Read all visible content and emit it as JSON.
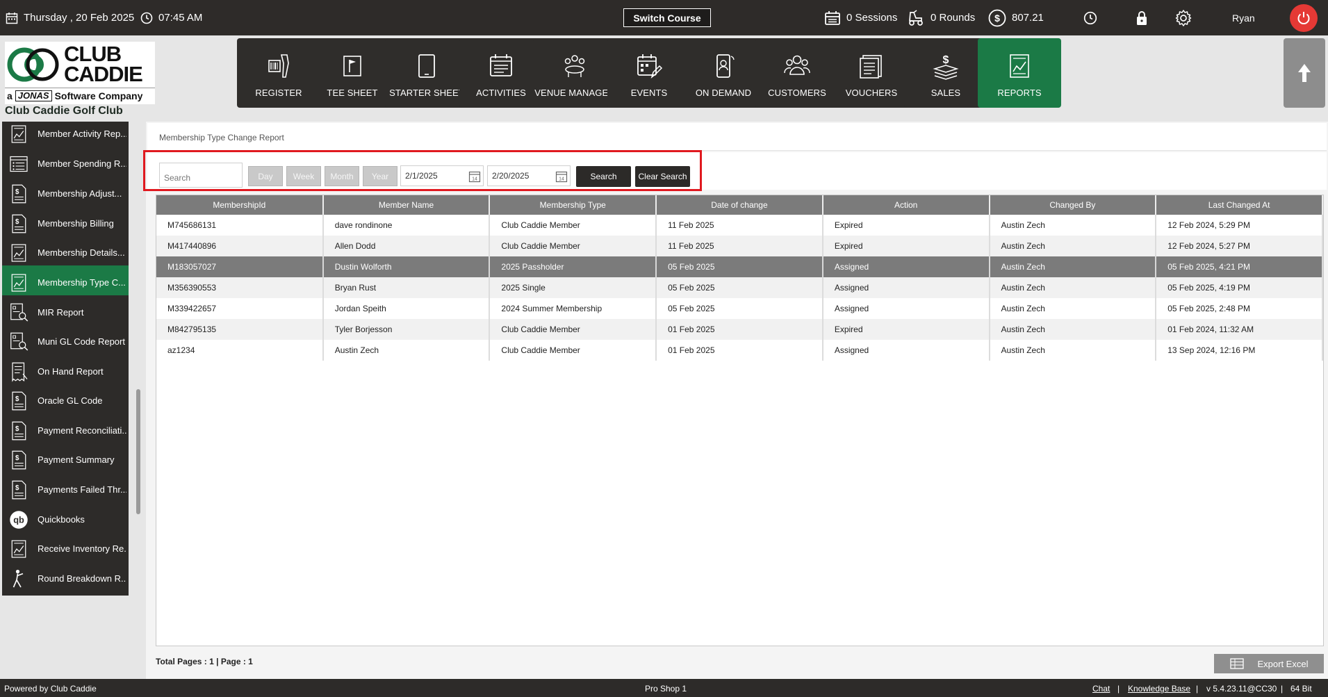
{
  "topbar": {
    "date": "Thursday ,  20 Feb 2025",
    "time": "07:45 AM",
    "switch_course": "Switch Course",
    "sessions": "0 Sessions",
    "rounds": "0 Rounds",
    "balance": "807.21",
    "user": "Ryan"
  },
  "header": {
    "logo_line1": "CLUB",
    "logo_line2": "CADDIE",
    "logo_prefix": "a",
    "logo_brand": "JONAS",
    "logo_tagline": "Software Company",
    "club_name": "Club Caddie Golf Club"
  },
  "nav": {
    "items": [
      {
        "label": "REGISTER",
        "icon": "scanner-icon"
      },
      {
        "label": "TEE SHEET",
        "icon": "flag-icon"
      },
      {
        "label": "STARTER SHEET",
        "icon": "tablet-icon"
      },
      {
        "label": "ACTIVITIES",
        "icon": "calendar-list-icon"
      },
      {
        "label": "VENUE MANAGER",
        "icon": "group-table-icon"
      },
      {
        "label": "EVENTS",
        "icon": "calendar-edit-icon"
      },
      {
        "label": "ON DEMAND",
        "icon": "mobile-icon"
      },
      {
        "label": "CUSTOMERS",
        "icon": "people-icon"
      },
      {
        "label": "VOUCHERS",
        "icon": "voucher-icon"
      },
      {
        "label": "SALES",
        "icon": "money-icon"
      },
      {
        "label": "REPORTS",
        "icon": "report-chart-icon"
      }
    ]
  },
  "sidebar": {
    "items": [
      {
        "label": "Member Activity Rep...",
        "icon": "report-chart-icon"
      },
      {
        "label": "Member Spending R...",
        "icon": "list-icon"
      },
      {
        "label": "Membership Adjust...",
        "icon": "dollar-doc-icon"
      },
      {
        "label": "Membership Billing",
        "icon": "dollar-doc-icon"
      },
      {
        "label": "Membership Details...",
        "icon": "report-chart-icon"
      },
      {
        "label": "Membership Type C...",
        "icon": "report-chart-icon"
      },
      {
        "label": "MIR Report",
        "icon": "search-doc-icon"
      },
      {
        "label": "Muni GL Code Report",
        "icon": "search-doc-icon"
      },
      {
        "label": "On Hand Report",
        "icon": "receipt-icon"
      },
      {
        "label": "Oracle GL Code",
        "icon": "dollar-doc-icon"
      },
      {
        "label": "Payment Reconciliati...",
        "icon": "dollar-doc-icon"
      },
      {
        "label": "Payment Summary",
        "icon": "dollar-doc-icon"
      },
      {
        "label": "Payments Failed Thr...",
        "icon": "dollar-doc-icon"
      },
      {
        "label": "Quickbooks",
        "icon": "quickbooks-icon"
      },
      {
        "label": "Receive Inventory Re...",
        "icon": "report-chart-icon"
      },
      {
        "label": "Round Breakdown R...",
        "icon": "golfer-icon"
      }
    ]
  },
  "main": {
    "breadcrumb": "Membership Type Change Report",
    "search_placeholder": "Search",
    "period_buttons": [
      "Day",
      "Week",
      "Month",
      "Year"
    ],
    "date_from": "2/1/2025",
    "date_to": "2/20/2025",
    "search_button": "Search",
    "clear_button": "Clear Search",
    "columns": [
      "MembershipId",
      "Member Name",
      "Membership Type",
      "Date of change",
      "Action",
      "Changed By",
      "Last Changed At"
    ],
    "rows": [
      [
        "M745686131",
        "dave rondinone",
        "Club Caddie Member",
        "11 Feb 2025",
        "Expired",
        "Austin Zech",
        "12 Feb 2024, 5:29 PM"
      ],
      [
        "M417440896",
        "Allen Dodd",
        "Club Caddie Member",
        "11 Feb 2025",
        "Expired",
        "Austin Zech",
        "12 Feb 2024, 5:27 PM"
      ],
      [
        "M183057027",
        "Dustin Wolforth",
        "2025 Passholder",
        "05 Feb 2025",
        "Assigned",
        "Austin Zech",
        "05 Feb 2025, 4:21 PM"
      ],
      [
        "M356390553",
        "Bryan Rust",
        "2025 Single",
        "05 Feb 2025",
        "Assigned",
        "Austin Zech",
        "05 Feb 2025, 4:19 PM"
      ],
      [
        "M339422657",
        "Jordan Speith",
        "2024 Summer Membership",
        "05 Feb 2025",
        "Assigned",
        "Austin Zech",
        "05 Feb 2025, 2:48 PM"
      ],
      [
        "M842795135",
        "Tyler Borjesson",
        "Club Caddie Member",
        "01 Feb 2025",
        "Expired",
        "Austin Zech",
        "01 Feb 2024, 11:32 AM"
      ],
      [
        "az1234",
        "Austin Zech",
        "Club Caddie Member",
        "01 Feb 2025",
        "Assigned",
        "Austin Zech",
        "13 Sep 2024, 12:16 PM"
      ]
    ],
    "pager": "Total Pages : 1 | Page : 1",
    "export_button": "Export Excel"
  },
  "footer": {
    "powered": "Powered by Club Caddie",
    "station": "Pro Shop 1",
    "chat": "Chat",
    "sep1": "|",
    "kb": "Knowledge Base",
    "sep2": "|",
    "version": "v 5.4.23.11@CC30",
    "sep3": "|",
    "bits": "64 Bit"
  },
  "colors": {
    "dark": "#2e2b29",
    "accent_green": "#1b7a46",
    "highlight_red": "#e0191f",
    "power_red": "#e53935"
  }
}
